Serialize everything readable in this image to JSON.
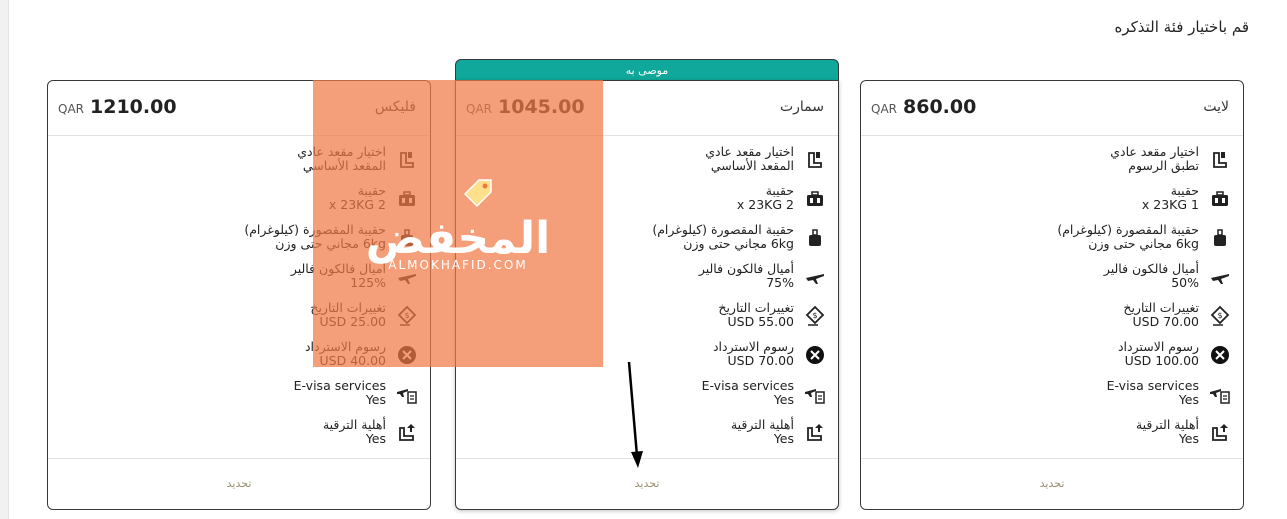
{
  "page": {
    "title": "قم باختيار فئة التذكره"
  },
  "recommended_banner": "موصى به",
  "cards": [
    {
      "name": "لايت",
      "currency": "QAR",
      "price": "860.00",
      "features": [
        {
          "icon": "seat-icon",
          "l1": "اختيار مقعد عادي",
          "l2": "تطبق الرسوم"
        },
        {
          "icon": "luggage-icon",
          "l1": "حقيبة",
          "l2": "1 x 23KG"
        },
        {
          "icon": "cabin-bag-icon",
          "l1": "حقيبة المقصورة (كيلوغرام)",
          "l2": "6kg مجاني حتى وزن"
        },
        {
          "icon": "plane-icon",
          "l1": "أميال فالكون فالير",
          "l2": "50%"
        },
        {
          "icon": "date-change-icon",
          "l1": "تغييرات التاريخ",
          "l2": "USD 70.00"
        },
        {
          "icon": "cancel-icon",
          "l1": "رسوم الاسترداد",
          "l2": "USD 100.00"
        },
        {
          "icon": "evisa-icon",
          "l1": "E-visa services",
          "l2": "Yes"
        },
        {
          "icon": "upgrade-icon",
          "l1": "أهلية الترقية",
          "l2": "Yes"
        }
      ],
      "select_label": "تحديد"
    },
    {
      "name": "سمارت",
      "currency": "QAR",
      "price": "1045.00",
      "features": [
        {
          "icon": "seat-icon",
          "l1": "اختيار مقعد عادي",
          "l2": "المقعد الأساسي"
        },
        {
          "icon": "luggage-icon",
          "l1": "حقيبة",
          "l2": "2 x 23KG"
        },
        {
          "icon": "cabin-bag-icon",
          "l1": "حقيبة المقصورة (كيلوغرام)",
          "l2": "6kg مجاني حتى وزن"
        },
        {
          "icon": "plane-icon",
          "l1": "أميال فالكون فالير",
          "l2": "75%"
        },
        {
          "icon": "date-change-icon",
          "l1": "تغييرات التاريخ",
          "l2": "USD 55.00"
        },
        {
          "icon": "cancel-icon",
          "l1": "رسوم الاسترداد",
          "l2": "USD 70.00"
        },
        {
          "icon": "evisa-icon",
          "l1": "E-visa services",
          "l2": "Yes"
        },
        {
          "icon": "upgrade-icon",
          "l1": "أهلية الترقية",
          "l2": "Yes"
        }
      ],
      "select_label": "تحديد"
    },
    {
      "name": "فليكس",
      "currency": "QAR",
      "price": "1210.00",
      "features": [
        {
          "icon": "seat-icon",
          "l1": "اختيار مقعد عادي",
          "l2": "المقعد الأساسي"
        },
        {
          "icon": "luggage-icon",
          "l1": "حقيبة",
          "l2": "2 x 23KG"
        },
        {
          "icon": "cabin-bag-icon",
          "l1": "حقيبة المقصورة (كيلوغرام)",
          "l2": "6kg مجاني حتى وزن"
        },
        {
          "icon": "plane-icon",
          "l1": "أميال فالكون فالير",
          "l2": "125%"
        },
        {
          "icon": "date-change-icon",
          "l1": "تغييرات التاريخ",
          "l2": "USD 25.00"
        },
        {
          "icon": "cancel-icon",
          "l1": "رسوم الاسترداد",
          "l2": "USD 40.00"
        },
        {
          "icon": "evisa-icon",
          "l1": "E-visa services",
          "l2": "Yes"
        },
        {
          "icon": "upgrade-icon",
          "l1": "أهلية الترقية",
          "l2": "Yes"
        }
      ],
      "select_label": "تحديد"
    }
  ],
  "watermark": {
    "text": "المخفض",
    "sub": "ALMOKHAFID.COM"
  },
  "colors": {
    "accent": "#0fa89a",
    "watermark": "#f07846",
    "select_text": "#9b8f6e"
  }
}
